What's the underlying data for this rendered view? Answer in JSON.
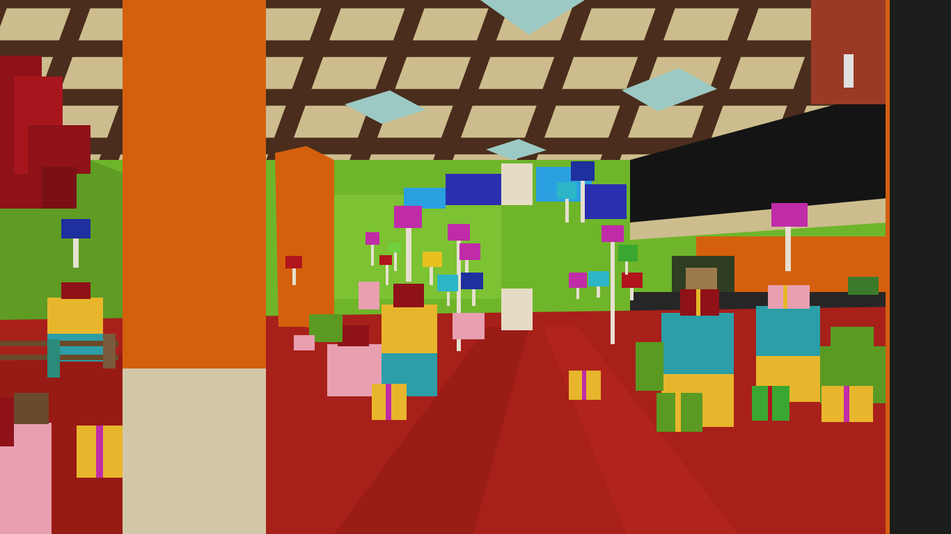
{
  "game": {
    "view": "first-person",
    "hud_visible": false
  },
  "palette": {
    "floor_red": "#a8201a",
    "floor_red_dark": "#7e1410",
    "wall_green": "#6fb52a",
    "ceiling_beam": "#4a2d1c",
    "ceiling_tile": "#cdbd8e",
    "pillar_orange": "#d4600e",
    "pillar_stone": "#d3c7a9",
    "stage_black": "#141414",
    "gift_yellow": "#e8b62c",
    "gift_cyan": "#2b9ea8",
    "gift_pink": "#e89fb0",
    "gift_green": "#5a9a22",
    "lollipop_magenta": "#c02ca8",
    "lollipop_blue": "#1e2f9e",
    "lollipop_cyan": "#2cb6c8",
    "lollipop_red": "#b0141c"
  }
}
